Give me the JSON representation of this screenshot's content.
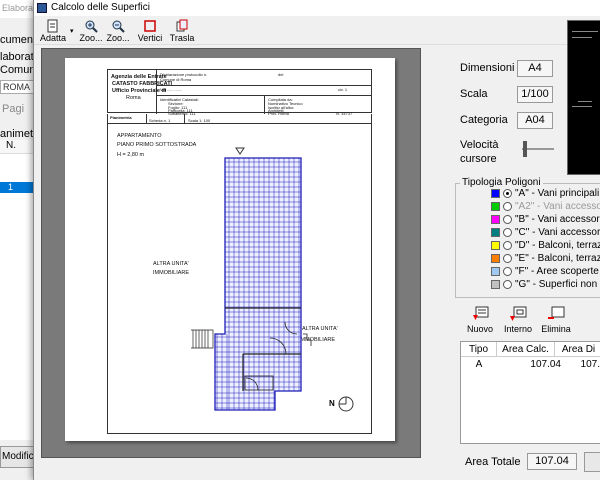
{
  "background_window": {
    "title": "Elaborat",
    "labels": [
      "cument",
      "laborat",
      "Comune",
      "Pagi",
      "animetr",
      "N.",
      "1",
      "Modifica"
    ],
    "field_value": "ROMA"
  },
  "window": {
    "title": "Calcolo delle Superfici"
  },
  "toolbar": [
    {
      "label": "Adatta",
      "icon": "document-fit-icon"
    },
    {
      "label": "Zoo...",
      "icon": "zoom-in-icon"
    },
    {
      "label": "Zoo...",
      "icon": "zoom-out-icon"
    },
    {
      "label": "Vertici",
      "icon": "vertices-icon"
    },
    {
      "label": "Trasla",
      "icon": "pan-icon"
    }
  ],
  "plan": {
    "agency_lines": [
      "Agenzia delle Entrate",
      "CATASTO FABBRICATI",
      "Ufficio Provinciale di",
      "Roma"
    ],
    "header_cells": [
      "Dichiarazione protocollo n.",
      "del",
      "Comune di Roma",
      "Via ..............",
      "civ. 1",
      "Identificativi Catastali:",
      "Sezione:",
      "Foglio: 111",
      "Particella: 111",
      "Subalterno: 111",
      "Compilata da:",
      "Nominativo Tecnico",
      "Iscritto all'albo:",
      "Architetti",
      "Prov. Roma",
      "N. 34737"
    ],
    "scheda": "Planimetria",
    "scheda_n": "Scheda n. 1",
    "scala": "Scala 1: 100",
    "room_title": [
      "APPARTAMENTO",
      "PIANO PRIMO SOTTOSTRADA"
    ],
    "height": "H = 2,80 m",
    "unit_left": [
      "ALTRA UNITA'",
      "IMMOBILIARE"
    ],
    "unit_right": [
      "ALTRA UNITA'",
      "IMMOBILIARE"
    ],
    "north": "N"
  },
  "properties": {
    "dimensioni_label": "Dimensioni",
    "dimensioni_value": "A4",
    "scala_label": "Scala",
    "scala_value": "1/100",
    "categoria_label": "Categoria",
    "categoria_value": "A04",
    "velocita_label": [
      "Velocità",
      "cursore"
    ],
    "velocita_level": 0.1
  },
  "tipologia": {
    "title": "Tipologia Poligoni",
    "items": [
      {
        "label": "\"A\" - Vani principali e acc",
        "color": "#0000ff",
        "selected": true,
        "disabled": false
      },
      {
        "label": "\"A2\" - Vani accessori dir",
        "color": "#00cc00",
        "selected": false,
        "disabled": true
      },
      {
        "label": "\"B\" - Vani accessori indir",
        "color": "#ff00ff",
        "selected": false,
        "disabled": false
      },
      {
        "label": "\"C\" - Vani accessori indir",
        "color": "#008080",
        "selected": false,
        "disabled": false
      },
      {
        "label": "\"D\" - Balconi, terrazzi e s",
        "color": "#ffff00",
        "selected": false,
        "disabled": false
      },
      {
        "label": "\"E\" - Balconi, terrazzi e s",
        "color": "#ff8000",
        "selected": false,
        "disabled": false
      },
      {
        "label": "\"F\" - Aree scoperte o ass",
        "color": "#a0c8f0",
        "selected": false,
        "disabled": false
      },
      {
        "label": "\"G\" - Superfici non rileva",
        "color": "#c0c0c0",
        "selected": false,
        "disabled": false
      }
    ]
  },
  "actions": {
    "nuovo": "Nuovo",
    "interno": "Interno",
    "elimina": "Elimina"
  },
  "table": {
    "columns": [
      "Tipo",
      "Area Calc.",
      "Area Di"
    ],
    "rows": [
      [
        "A",
        "107.04",
        "107."
      ]
    ]
  },
  "total": {
    "label": "Area Totale",
    "value": "107.04"
  }
}
